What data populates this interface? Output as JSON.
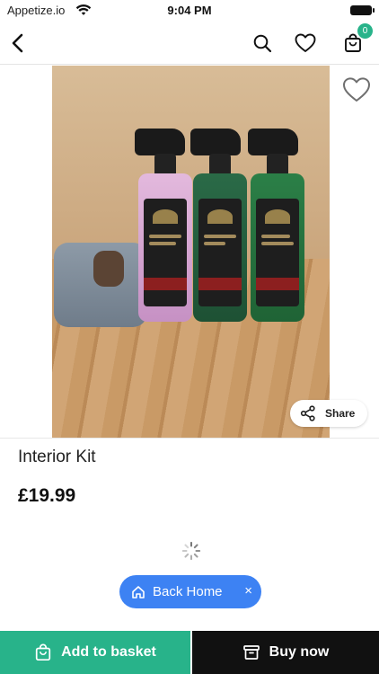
{
  "status_bar": {
    "carrier": "Appetize.io",
    "time": "9:04 PM"
  },
  "nav": {
    "basket_count": "0"
  },
  "product": {
    "title": "Interior Kit",
    "price": "£19.99"
  },
  "share": {
    "label": "Share"
  },
  "back_home": {
    "label": "Back Home",
    "close": "×"
  },
  "actions": {
    "add_to_basket": "Add to basket",
    "buy_now": "Buy now"
  },
  "icons": {
    "back": "chevron-left-icon",
    "search": "search-icon",
    "wishlist": "heart-icon",
    "basket": "shopping-bag-icon",
    "share": "share-icon",
    "home": "home-icon",
    "spinner": "loading-spinner-icon"
  },
  "colors": {
    "accent_green": "#28b38a",
    "buy_now_bg": "#111111",
    "back_home_blue": "#3d82f3"
  }
}
